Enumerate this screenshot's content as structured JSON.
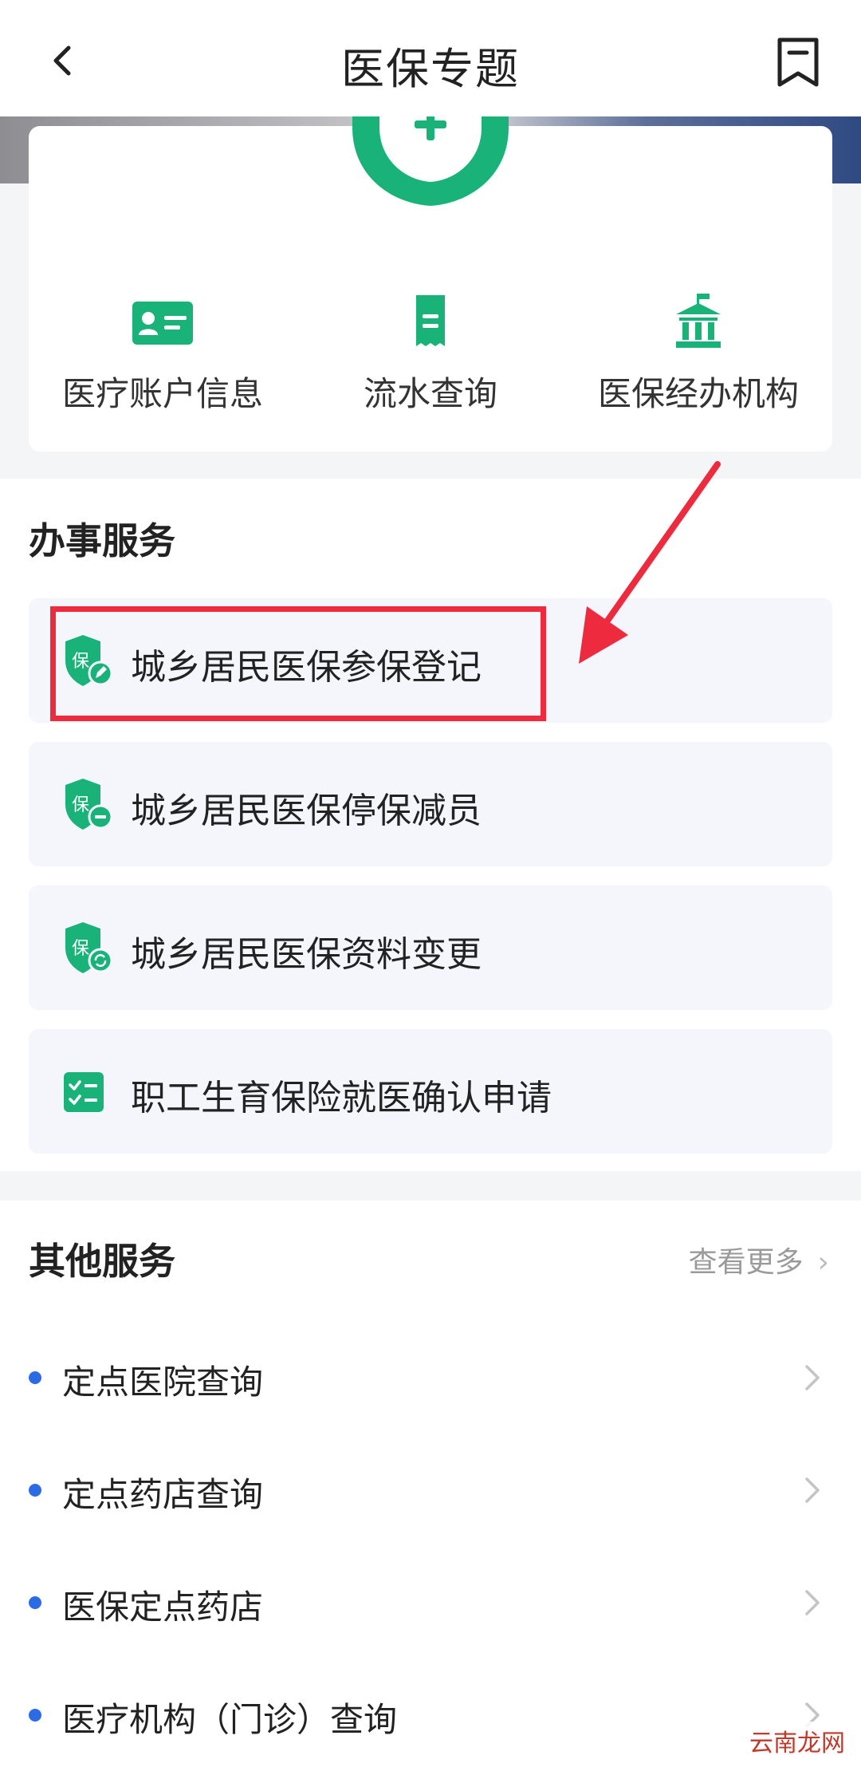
{
  "header": {
    "title": "医保专题"
  },
  "quick_actions": [
    {
      "label": "医疗账户信息",
      "icon": "id-card-icon"
    },
    {
      "label": "流水查询",
      "icon": "receipt-icon"
    },
    {
      "label": "医保经办机构",
      "icon": "institution-icon"
    }
  ],
  "services": {
    "title": "办事服务",
    "items": [
      {
        "label": "城乡居民医保参保登记",
        "icon": "insurance-edit-icon"
      },
      {
        "label": "城乡居民医保停保减员",
        "icon": "insurance-minus-icon"
      },
      {
        "label": "城乡居民医保资料变更",
        "icon": "insurance-refresh-icon"
      },
      {
        "label": "职工生育保险就医确认申请",
        "icon": "checklist-icon"
      }
    ]
  },
  "other_services": {
    "title": "其他服务",
    "more_label": "查看更多",
    "items": [
      {
        "label": "定点医院查询"
      },
      {
        "label": "定点药店查询"
      },
      {
        "label": "医保定点药店"
      },
      {
        "label": "医疗机构（门诊）查询"
      }
    ]
  },
  "watermark": "云南龙网",
  "colors": {
    "brand_green": "#19b37a",
    "highlight_red": "#ee2a3e",
    "dot_blue": "#2b6be6"
  }
}
